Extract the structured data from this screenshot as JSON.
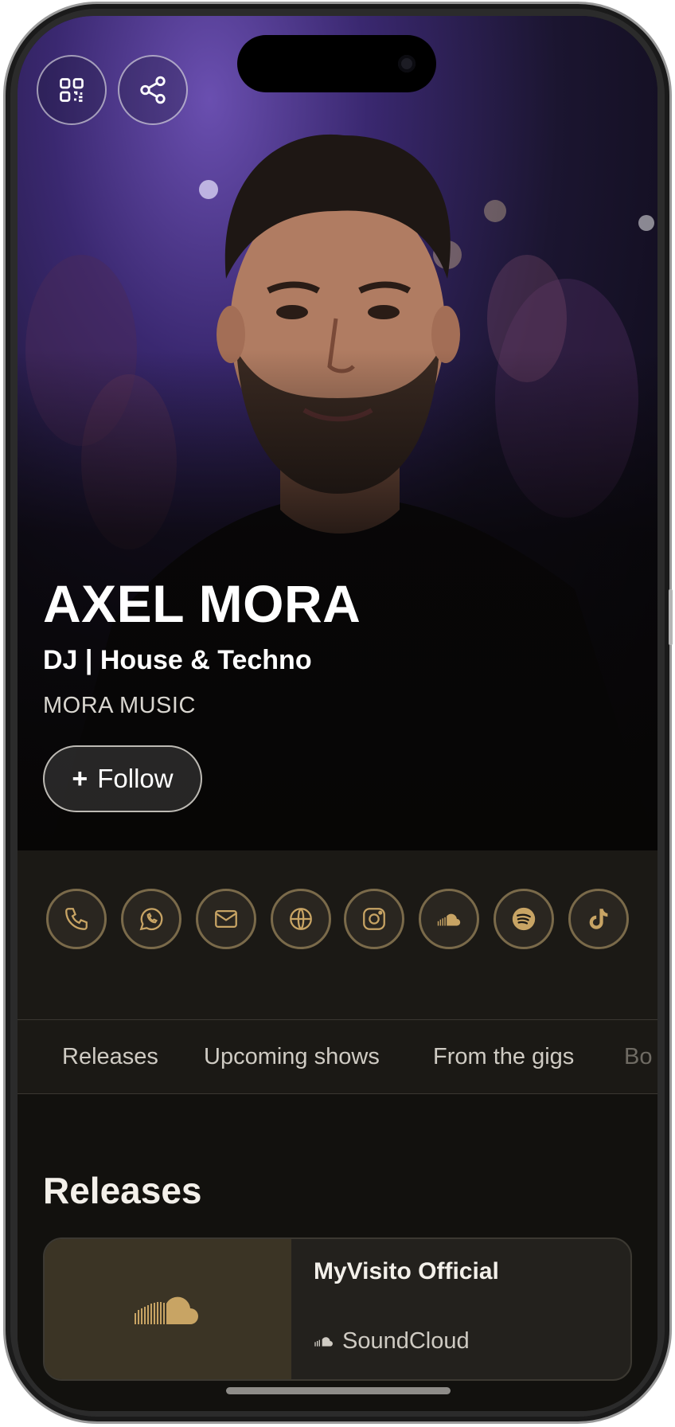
{
  "profile": {
    "name": "AXEL MORA",
    "subtitle": "DJ | House & Techno",
    "label": "MORA MUSIC",
    "follow_plus": "+",
    "follow_label": "Follow"
  },
  "top_actions": [
    {
      "icon": "qr-code-icon"
    },
    {
      "icon": "share-icon"
    }
  ],
  "contacts": [
    {
      "icon": "phone-icon"
    },
    {
      "icon": "whatsapp-icon"
    },
    {
      "icon": "mail-icon"
    },
    {
      "icon": "globe-icon"
    },
    {
      "icon": "instagram-icon"
    },
    {
      "icon": "soundcloud-icon"
    },
    {
      "icon": "spotify-icon"
    },
    {
      "icon": "tiktok-icon"
    }
  ],
  "tabs": [
    {
      "label": "Releases"
    },
    {
      "label": "Upcoming shows"
    },
    {
      "label": "From the gigs"
    },
    {
      "label": "Bo"
    }
  ],
  "releases": {
    "title": "Releases",
    "items": [
      {
        "title": "MyVisito Official",
        "source": "SoundCloud",
        "icon": "soundcloud-icon"
      }
    ]
  },
  "colors": {
    "accent_gold": "#c8a464",
    "background": "#12110e",
    "panel": "#1b1915"
  }
}
